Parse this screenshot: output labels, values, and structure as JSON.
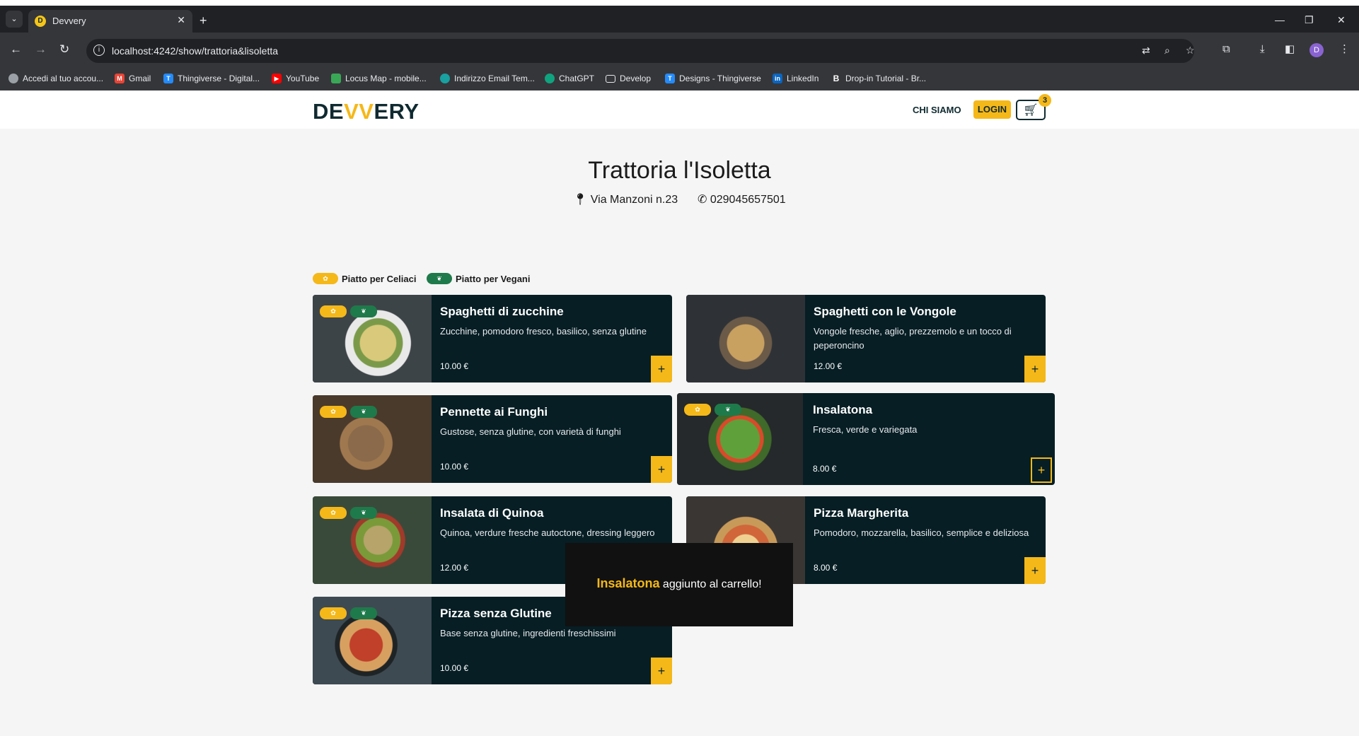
{
  "browser": {
    "tab_title": "Devvery",
    "tab_favicon": "D",
    "url": "localhost:4242/show/trattoria&lisoletta",
    "profile_initial": "D",
    "bookmarks": [
      {
        "label": "Accedi al tuo accou...",
        "icon": "google-account-icon",
        "color": "#9aa0a6"
      },
      {
        "label": "Gmail",
        "icon": "gmail-icon",
        "color": "#ea4335"
      },
      {
        "label": "Thingiverse - Digital...",
        "icon": "thingiverse-icon",
        "color": "#248bfb"
      },
      {
        "label": "YouTube",
        "icon": "youtube-icon",
        "color": "#ff0000"
      },
      {
        "label": "Locus Map - mobile...",
        "icon": "locus-map-icon",
        "color": "#3aa757"
      },
      {
        "label": "Indirizzo Email Tem...",
        "icon": "temp-mail-icon",
        "color": "#19a0a0"
      },
      {
        "label": "ChatGPT",
        "icon": "chatgpt-icon",
        "color": "#10a37f"
      },
      {
        "label": "Develop",
        "icon": "folder-icon",
        "color": "#35363a"
      },
      {
        "label": "Designs - Thingiverse",
        "icon": "thingiverse-icon",
        "color": "#248bfb"
      },
      {
        "label": "LinkedIn",
        "icon": "linkedin-icon",
        "color": "#0a66c2"
      },
      {
        "label": "Drop-in Tutorial - Br...",
        "icon": "braintree-icon",
        "color": "#ffffff"
      }
    ]
  },
  "navbar": {
    "logo_left": "DE",
    "logo_accent": "VV",
    "logo_right": "ERY",
    "about_label": "CHI SIAMO",
    "login_label": "LOGIN",
    "cart_count": "3"
  },
  "restaurant": {
    "name": "Trattoria l'Isoletta",
    "address": "Via Manzoni n.23",
    "phone": "029045657501"
  },
  "legend": {
    "celiac_label": "Piatto per Celiaci",
    "vegan_label": "Piatto per Vegani"
  },
  "dishes": [
    {
      "name": "Spaghetti di zucchine",
      "description": "Zucchine, pomodoro fresco, basilico, senza glutine",
      "price": "10.00 €",
      "gluten_free": true,
      "vegan": true
    },
    {
      "name": "Spaghetti con le Vongole",
      "description": "Vongole fresche, aglio, prezzemolo e un tocco di peperoncino",
      "price": "12.00 €",
      "gluten_free": false,
      "vegan": false
    },
    {
      "name": "Pennette ai Funghi",
      "description": "Gustose, senza glutine, con varietà di funghi",
      "price": "10.00 €",
      "gluten_free": true,
      "vegan": true
    },
    {
      "name": "Insalatona",
      "description": "Fresca, verde e variegata",
      "price": "8.00 €",
      "gluten_free": true,
      "vegan": true
    },
    {
      "name": "Insalata di Quinoa",
      "description": "Quinoa, verdure fresche autoctone, dressing leggero",
      "price": "12.00 €",
      "gluten_free": true,
      "vegan": true
    },
    {
      "name": "Pizza Margherita",
      "description": "Pomodoro, mozzarella, basilico, semplice e deliziosa",
      "price": "8.00 €",
      "gluten_free": false,
      "vegan": false
    },
    {
      "name": "Pizza senza Glutine",
      "description": "Base senza glutine, ingredienti freschissimi",
      "price": "10.00 €",
      "gluten_free": true,
      "vegan": true
    }
  ],
  "toast": {
    "item": "Insalatona",
    "message": "aggiunto al carrello!"
  },
  "colors": {
    "brand_dark": "#061e24",
    "brand_accent": "#f5b819",
    "vegan_green": "#1e7a4a"
  }
}
